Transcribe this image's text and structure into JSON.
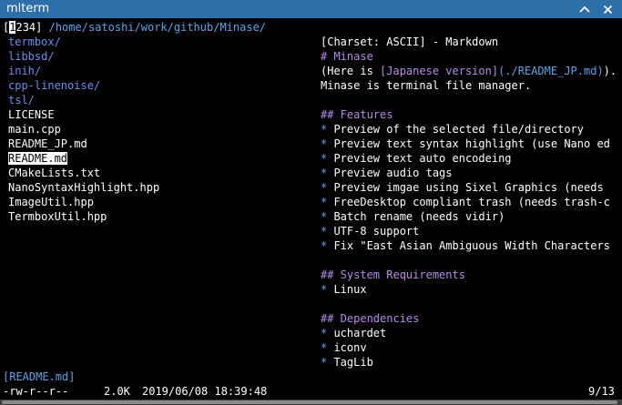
{
  "window": {
    "title": "mlterm"
  },
  "header": {
    "tabs_prefix": "[",
    "active_tab": "1",
    "tabs_rest": "234]",
    "path": "/home/satoshi/work/github/Minase/"
  },
  "files": [
    {
      "name": "termbox/",
      "type": "dir"
    },
    {
      "name": "libbsd/",
      "type": "dir"
    },
    {
      "name": "inih/",
      "type": "dir"
    },
    {
      "name": "cpp-linenoise/",
      "type": "dir"
    },
    {
      "name": "tsl/",
      "type": "dir"
    },
    {
      "name": "LICENSE",
      "type": "file"
    },
    {
      "name": "main.cpp",
      "type": "file"
    },
    {
      "name": "README_JP.md",
      "type": "file"
    },
    {
      "name": "README.md",
      "type": "file",
      "selected": true
    },
    {
      "name": "CMakeLists.txt",
      "type": "file"
    },
    {
      "name": "NanoSyntaxHighlight.hpp",
      "type": "file"
    },
    {
      "name": "ImageUtil.hpp",
      "type": "file"
    },
    {
      "name": "TermboxUtil.hpp",
      "type": "file"
    }
  ],
  "preview": [
    {
      "row": 1,
      "parts": [
        {
          "t": "[Charset: ASCII] - Markdown",
          "c": "white"
        }
      ]
    },
    {
      "row": 2,
      "parts": [
        {
          "t": "# Minase",
          "c": "purple"
        }
      ]
    },
    {
      "row": 3,
      "parts": [
        {
          "t": "(Here is ",
          "c": "white"
        },
        {
          "t": "[Japanese version]",
          "c": "purple"
        },
        {
          "t": "(./README_JP.md)",
          "c": "cyan"
        },
        {
          "t": ").",
          "c": "white"
        }
      ]
    },
    {
      "row": 4,
      "parts": [
        {
          "t": "Minase is terminal file manager.",
          "c": "white"
        }
      ]
    },
    {
      "row": 6,
      "parts": [
        {
          "t": "## Features",
          "c": "purple"
        }
      ]
    },
    {
      "row": 7,
      "parts": [
        {
          "t": "* ",
          "c": "cyan"
        },
        {
          "t": "Preview of the selected file/directory",
          "c": "white"
        }
      ]
    },
    {
      "row": 8,
      "parts": [
        {
          "t": "* ",
          "c": "cyan"
        },
        {
          "t": "Preview text syntax highlight (use Nano ed",
          "c": "white"
        }
      ]
    },
    {
      "row": 9,
      "parts": [
        {
          "t": "* ",
          "c": "cyan"
        },
        {
          "t": "Preview text auto encodeing",
          "c": "white"
        }
      ]
    },
    {
      "row": 10,
      "parts": [
        {
          "t": "* ",
          "c": "cyan"
        },
        {
          "t": "Preview audio tags",
          "c": "white"
        }
      ]
    },
    {
      "row": 11,
      "parts": [
        {
          "t": "* ",
          "c": "cyan"
        },
        {
          "t": "Preview imgae using Sixel Graphics (needs",
          "c": "white"
        }
      ]
    },
    {
      "row": 12,
      "parts": [
        {
          "t": "* ",
          "c": "cyan"
        },
        {
          "t": "FreeDesktop compliant trash (needs trash-c",
          "c": "white"
        }
      ]
    },
    {
      "row": 13,
      "parts": [
        {
          "t": "* ",
          "c": "cyan"
        },
        {
          "t": "Batch rename (needs vidir)",
          "c": "white"
        }
      ]
    },
    {
      "row": 14,
      "parts": [
        {
          "t": "* ",
          "c": "cyan"
        },
        {
          "t": "UTF-8 support",
          "c": "white"
        }
      ]
    },
    {
      "row": 15,
      "parts": [
        {
          "t": "* ",
          "c": "cyan"
        },
        {
          "t": "Fix \"East Asian Ambiguous Width Characters",
          "c": "white"
        }
      ]
    },
    {
      "row": 17,
      "parts": [
        {
          "t": "## System Requirements",
          "c": "purple"
        }
      ]
    },
    {
      "row": 18,
      "parts": [
        {
          "t": "* ",
          "c": "cyan"
        },
        {
          "t": "Linux",
          "c": "white"
        }
      ]
    },
    {
      "row": 20,
      "parts": [
        {
          "t": "## Dependencies",
          "c": "purple"
        }
      ]
    },
    {
      "row": 21,
      "parts": [
        {
          "t": "* ",
          "c": "cyan"
        },
        {
          "t": "uchardet",
          "c": "white"
        }
      ]
    },
    {
      "row": 22,
      "parts": [
        {
          "t": "* ",
          "c": "cyan"
        },
        {
          "t": "iconv",
          "c": "white"
        }
      ]
    },
    {
      "row": 23,
      "parts": [
        {
          "t": "* ",
          "c": "cyan"
        },
        {
          "t": "TagLib",
          "c": "white"
        }
      ]
    }
  ],
  "status": {
    "selected_file": "[README.md]",
    "perms": "-rw-r--r--",
    "size": "2.0K",
    "date": "2019/06/08 18:39:48",
    "position": "9/13"
  },
  "colors": {
    "titlebar": "#2d6fa8",
    "dir": "#6a8ff0",
    "cyan": "#56a5ec",
    "purple": "#b48ce6",
    "text": "#ffffff",
    "background": "#000000"
  },
  "icons": [
    "chevron-up-icon",
    "close-icon"
  ]
}
